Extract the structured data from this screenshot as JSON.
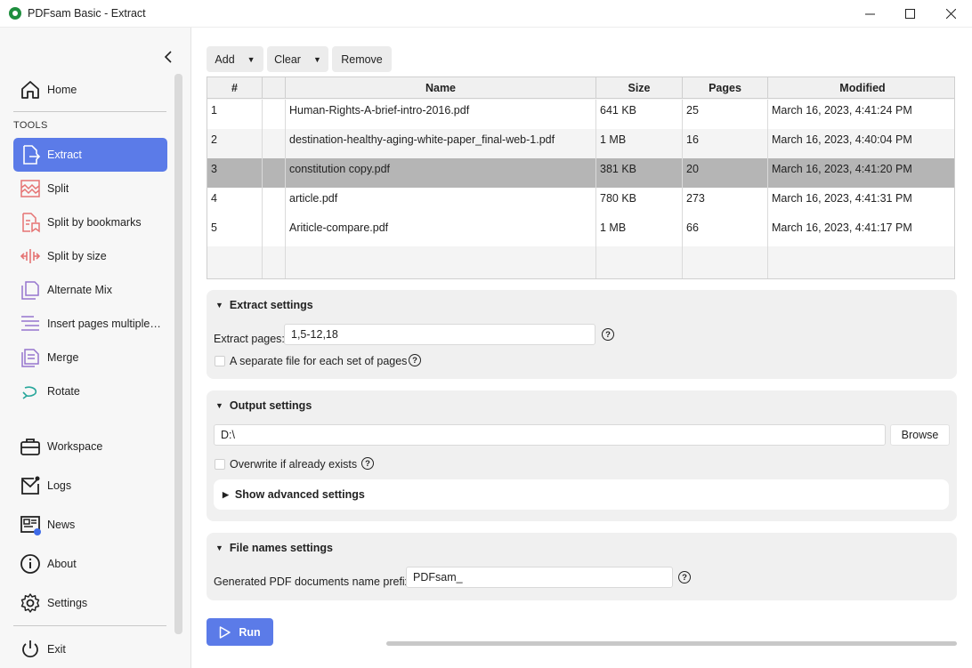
{
  "window": {
    "title": "PDFsam Basic - Extract",
    "minimize": "—",
    "maximize": "☐",
    "close": "✕"
  },
  "sidebar": {
    "collapse_icon": "chevron-left-icon",
    "home": {
      "label": "Home",
      "icon": "home-icon"
    },
    "tools_heading": "TOOLS",
    "tools": [
      {
        "label": "Extract",
        "icon": "extract-icon",
        "color": "#5b7be8",
        "active": true
      },
      {
        "label": "Split",
        "icon": "split-icon",
        "color": "#e57373"
      },
      {
        "label": "Split by bookmarks",
        "icon": "split-bookmarks-icon",
        "color": "#e57373"
      },
      {
        "label": "Split by size",
        "icon": "split-size-icon",
        "color": "#e57373"
      },
      {
        "label": "Alternate Mix",
        "icon": "alternate-mix-icon",
        "color": "#9575cd"
      },
      {
        "label": "Insert pages multiple t...",
        "icon": "insert-pages-icon",
        "color": "#9575cd"
      },
      {
        "label": "Merge",
        "icon": "merge-icon",
        "color": "#9575cd"
      },
      {
        "label": "Rotate",
        "icon": "rotate-icon",
        "color": "#26a69a"
      }
    ],
    "bottom": [
      {
        "label": "Workspace",
        "icon": "briefcase-icon"
      },
      {
        "label": "Logs",
        "icon": "logs-icon"
      },
      {
        "label": "News",
        "icon": "news-icon"
      },
      {
        "label": "About",
        "icon": "info-icon"
      },
      {
        "label": "Settings",
        "icon": "gear-icon"
      }
    ],
    "exit": {
      "label": "Exit",
      "icon": "power-icon"
    }
  },
  "toolbar": {
    "add": "Add",
    "clear": "Clear",
    "remove": "Remove",
    "caret": "▼"
  },
  "table": {
    "columns": [
      "#",
      "",
      "Name",
      "Size",
      "Pages",
      "Modified"
    ],
    "rows": [
      {
        "num": "1",
        "name": "Human-Rights-A-brief-intro-2016.pdf",
        "size": "641 KB",
        "pages": "25",
        "modified": "March 16, 2023, 4:41:24 PM"
      },
      {
        "num": "2",
        "name": "destination-healthy-aging-white-paper_final-web-1.pdf",
        "size": "1 MB",
        "pages": "16",
        "modified": "March 16, 2023, 4:40:04 PM"
      },
      {
        "num": "3",
        "name": "constitution copy.pdf",
        "size": "381 KB",
        "pages": "20",
        "modified": "March 16, 2023, 4:41:20 PM"
      },
      {
        "num": "4",
        "name": "article.pdf",
        "size": "780 KB",
        "pages": "273",
        "modified": "March 16, 2023, 4:41:31 PM"
      },
      {
        "num": "5",
        "name": "Ariticle-compare.pdf",
        "size": "1 MB",
        "pages": "66",
        "modified": "March 16, 2023, 4:41:17 PM"
      }
    ],
    "selected_row": 3
  },
  "extract_settings": {
    "title": "Extract settings",
    "pages_label": "Extract pages:",
    "pages_value": "1,5-12,18",
    "separate_label": "A separate file for each set of pages"
  },
  "output_settings": {
    "title": "Output settings",
    "path_value": "D:\\",
    "browse": "Browse",
    "overwrite_label": "Overwrite if already exists",
    "advanced_label": "Show advanced settings"
  },
  "file_names": {
    "title": "File names settings",
    "prefix_label": "Generated PDF documents name prefix:",
    "prefix_value": "PDFsam_"
  },
  "run_label": "Run",
  "help_glyph": "?",
  "arrow_down": "▼",
  "arrow_right": "▶",
  "colors": {
    "accent": "#5b7be8",
    "selected_row": "#b5b5b5",
    "panel_bg": "#f0f0f0"
  }
}
